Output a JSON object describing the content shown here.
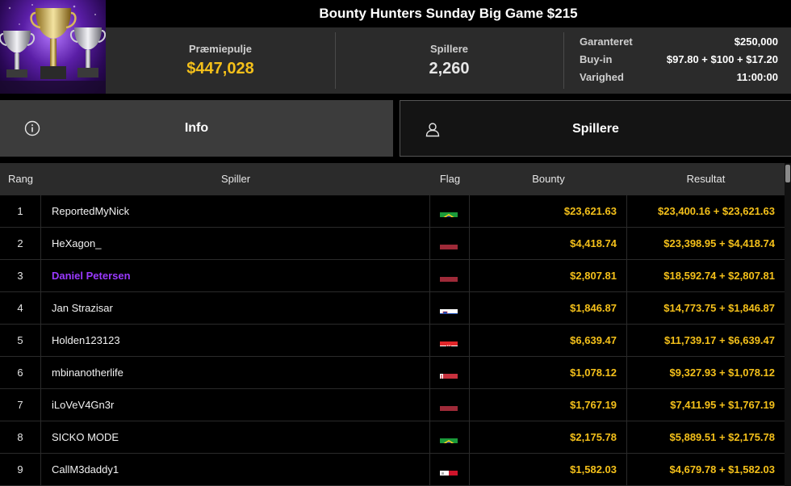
{
  "header": {
    "title": "Bounty Hunters Sunday Big Game $215",
    "prize_label": "Præmiepulje",
    "prize_value": "$447,028",
    "players_label": "Spillere",
    "players_value": "2,260",
    "details": [
      {
        "label": "Garanteret",
        "value": "$250,000"
      },
      {
        "label": "Buy-in",
        "value": "$97.80 + $100 + $17.20"
      },
      {
        "label": "Varighed",
        "value": "11:00:00"
      }
    ]
  },
  "tabs": [
    {
      "label": "Info",
      "icon": "info-icon",
      "active": true
    },
    {
      "label": "Spillere",
      "icon": "user-icon",
      "active": false
    }
  ],
  "table": {
    "columns": [
      "Rang",
      "Spiller",
      "Flag",
      "Bounty",
      "Resultat"
    ],
    "rows": [
      {
        "rank": "1",
        "player": "ReportedMyNick",
        "flag": "brazil-flag",
        "bounty": "$23,621.63",
        "result": "$23,400.16 + $23,621.63"
      },
      {
        "rank": "2",
        "player": "HeXagon_",
        "flag": "latvia-flag",
        "bounty": "$4,418.74",
        "result": "$23,398.95 + $4,418.74"
      },
      {
        "rank": "3",
        "player": "Daniel Petersen",
        "flag": "latvia-flag",
        "bounty": "$2,807.81",
        "result": "$18,592.74 + $2,807.81",
        "highlight": true
      },
      {
        "rank": "4",
        "player": "Jan Strazisar",
        "flag": "slovenia-flag",
        "bounty": "$1,846.87",
        "result": "$14,773.75 + $1,846.87"
      },
      {
        "rank": "5",
        "player": "Holden123123",
        "flag": "croatia-flag",
        "bounty": "$6,639.47",
        "result": "$11,739.17 + $6,639.47"
      },
      {
        "rank": "6",
        "player": "mbinanotherlife",
        "flag": "belarus-flag",
        "bounty": "$1,078.12",
        "result": "$9,327.93 + $1,078.12"
      },
      {
        "rank": "7",
        "player": "iLoVeV4Gn3r",
        "flag": "latvia-flag",
        "bounty": "$1,767.19",
        "result": "$7,411.95 + $1,767.19"
      },
      {
        "rank": "8",
        "player": "SICKO MODE",
        "flag": "brazil-flag",
        "bounty": "$2,175.78",
        "result": "$5,889.51 + $2,175.78"
      },
      {
        "rank": "9",
        "player": "CallM3daddy1",
        "flag": "malta-flag",
        "bounty": "$1,582.03",
        "result": "$4,679.78 + $1,582.03"
      }
    ]
  },
  "colors": {
    "gold": "#f4c01a",
    "highlight_name": "#9a39ff",
    "header_bg": "#2b2b2b",
    "active_tab_bg": "#3c3c3c"
  }
}
